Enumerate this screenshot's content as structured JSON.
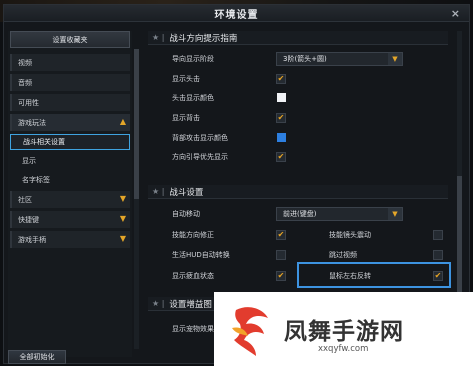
{
  "window": {
    "title": "环境设置",
    "close": "×"
  },
  "sidebar": {
    "favorites_button": "设置收藏夹",
    "items": [
      {
        "label": "视频"
      },
      {
        "label": "音频"
      },
      {
        "label": "可用性"
      },
      {
        "label": "游戏玩法",
        "expanded": true,
        "arrow": "▲"
      }
    ],
    "sub_items": [
      {
        "label": "战斗相关设置",
        "active": true
      },
      {
        "label": "显示"
      },
      {
        "label": "名字标签"
      }
    ],
    "items_after": [
      {
        "label": "社区",
        "arrow": "▼"
      },
      {
        "label": "快捷键",
        "arrow": "▼"
      },
      {
        "label": "游戏手柄",
        "arrow": "▼"
      }
    ],
    "reset_button": "全部初始化"
  },
  "sections": {
    "combat_guide": {
      "title": "战斗方向提示指南",
      "stage_label": "导向显示阶段",
      "stage_value": "3阶(箭头+圆)",
      "head_hit": "显示头击",
      "head_hit_color": "头击显示颜色",
      "back_hit": "显示背击",
      "back_hit_color": "背部攻击显示颜色",
      "guide_priority": "方向引导优先显示"
    },
    "combat_settings": {
      "title": "战斗设置",
      "auto_move": "自动移动",
      "auto_move_value": "前进(键盘)",
      "skill_dir_fix": "技能方向修正",
      "skill_cam_shake": "技能镜头震动",
      "hud_auto": "生活HUD自动转换",
      "skip_video": "跳过视频",
      "show_fatigue": "显示疲血状态",
      "mouse_invert": "鼠标左右反转"
    },
    "pet_settings": {
      "title": "设置增益图",
      "pet_effect": "显示宠物效果"
    }
  },
  "watermark": {
    "brand": "凤舞手游网",
    "url": "xxqyfw.com"
  },
  "colors": {
    "accent": "#e4a629",
    "highlight": "#3d93e0",
    "blue_swatch": "#2d7fe0",
    "white_swatch": "#f1f3f6"
  }
}
